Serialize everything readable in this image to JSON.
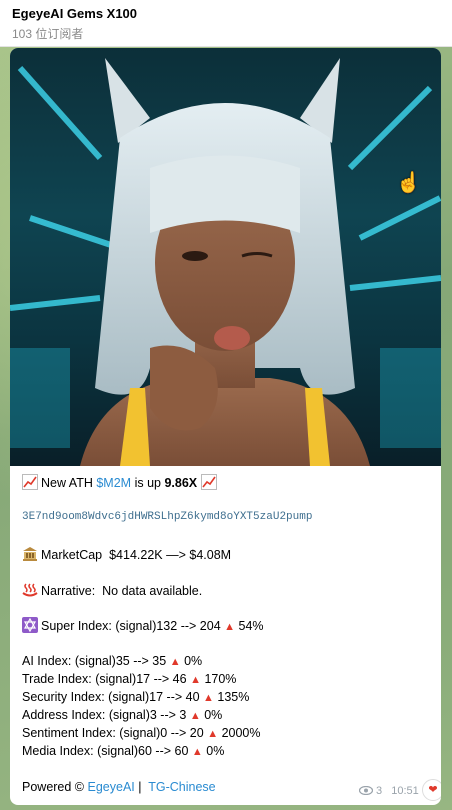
{
  "channel": {
    "title": "EgeyeAI Gems X100",
    "subscribers": "103 位订阅者"
  },
  "message": {
    "ath_prefix": "New ATH",
    "token": "$M2M",
    "ath_mid": "is up",
    "multiplier": "9.86X",
    "contract": "3E7nd9oom8Wdvc6jdHWRSLhpZ6kymd8oYXT5zaU2pump",
    "marketcap_label": "MarketCap",
    "marketcap_value": "$414.22K —> $4.08M",
    "narrative_label": "Narrative:",
    "narrative_value": "No data available.",
    "super_index_label": "Super Index:",
    "super_index_value": "(signal)132 --> 204",
    "super_index_pct": "54%",
    "indices": [
      {
        "label": "AI Index:",
        "value": "(signal)35 --> 35",
        "pct": "0%"
      },
      {
        "label": "Trade Index:",
        "value": "(signal)17 --> 46",
        "pct": "170%"
      },
      {
        "label": "Security Index:",
        "value": "(signal)17 --> 40",
        "pct": "135%"
      },
      {
        "label": "Address Index:",
        "value": "(signal)3 --> 3",
        "pct": "0%"
      },
      {
        "label": "Sentiment Index:",
        "value": "(signal)0 --> 20",
        "pct": "2000%"
      },
      {
        "label": "Media Index:",
        "value": "(signal)60 --> 60",
        "pct": "0%"
      }
    ],
    "powered_prefix": "Powered ©",
    "powered_link": "EgeyeAI",
    "separator": "|",
    "tg_link": "TG-Chinese",
    "views": "3",
    "time": "10:51"
  },
  "icons": {
    "chart": "chart-increasing-icon",
    "bank": "bank-icon",
    "hotspring": "hot-springs-icon",
    "star": "star-of-david-icon",
    "up": "red-triangle-up-icon",
    "eye": "eye-icon",
    "heart": "heart-reaction-icon"
  },
  "colors": {
    "link": "#2a8bd1",
    "up": "#e0392b",
    "contract": "#3f6f8f"
  }
}
